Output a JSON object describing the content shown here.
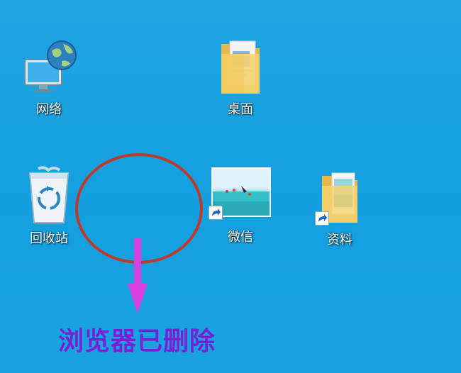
{
  "desktop": {
    "background_color": "#1aa3e2",
    "icons": [
      {
        "label": "网络",
        "icon": "network-icon"
      },
      {
        "label": "桌面",
        "icon": "folder-icon"
      },
      {
        "label": "回收站",
        "icon": "recycle-bin-icon"
      },
      {
        "label": "微信",
        "icon": "image-shortcut-icon"
      },
      {
        "label": "资料",
        "icon": "folder-shortcut-icon"
      }
    ]
  },
  "annotation": {
    "text": "浏览器已删除",
    "color": "#7a1fd6",
    "circle_color": "#c0392b",
    "arrow_color": "#d63fe0"
  }
}
